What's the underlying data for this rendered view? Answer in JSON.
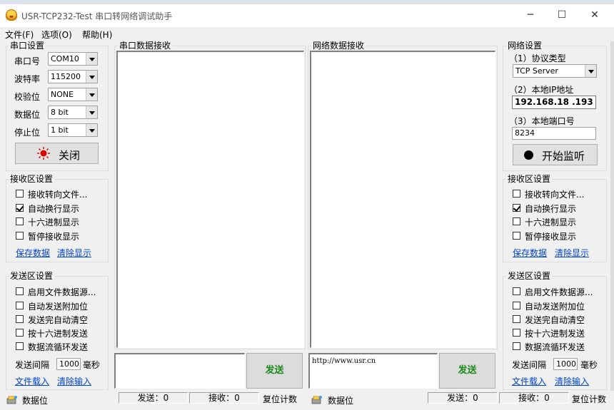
{
  "window": {
    "title": "USR-TCP232-Test 串口转网络调试助手",
    "minimize": "─",
    "maximize": "☐",
    "close": "✕"
  },
  "menu": [
    "文件(F)",
    "选项(O)",
    "帮助(H)"
  ],
  "serial": {
    "group_title": "串口设置",
    "port_label": "串口号",
    "port_value": "COM10",
    "baud_label": "波特率",
    "baud_value": "115200",
    "parity_label": "校验位",
    "parity_value": "NONE",
    "databits_label": "数据位",
    "databits_value": "8 bit",
    "stopbits_label": "停止位",
    "stopbits_value": "1 bit",
    "close_button": "关闭"
  },
  "left_recv": {
    "group_title": "接收区设置",
    "options": [
      {
        "label": "接收转向文件...",
        "checked": false
      },
      {
        "label": "自动换行显示",
        "checked": true
      },
      {
        "label": "十六进制显示",
        "checked": false
      },
      {
        "label": "暂停接收显示",
        "checked": false
      }
    ],
    "save_link": "保存数据",
    "clear_link": "清除显示"
  },
  "left_send": {
    "group_title": "发送区设置",
    "options": [
      {
        "label": "启用文件数据源...",
        "checked": false
      },
      {
        "label": "自动发送附加位",
        "checked": false
      },
      {
        "label": "发送完自动清空",
        "checked": false
      },
      {
        "label": "按十六进制发送",
        "checked": false
      },
      {
        "label": "数据流循环发送",
        "checked": false
      }
    ],
    "interval_label": "发送间隔",
    "interval_value": "1000",
    "interval_unit": "毫秒",
    "file_link": "文件载入",
    "clear_link": "清除输入"
  },
  "serial_recv_title": "串口数据接收",
  "net_recv_title": "网络数据接收",
  "serial_send_button": "发送",
  "net_send_text": "http://www.usr.cn",
  "net_send_button": "发送",
  "network": {
    "group_title": "网络设置",
    "protocol_label": "（1）协议类型",
    "protocol_value": "TCP Server",
    "ip_label": "（2）本地IP地址",
    "ip_value": "192.168.18 .193",
    "port_label": "（3）本地端口号",
    "port_value": "8234",
    "listen_button": "开始监听"
  },
  "right_recv": {
    "group_title": "接收区设置",
    "options": [
      {
        "label": "接收转向文件...",
        "checked": false
      },
      {
        "label": "自动换行显示",
        "checked": true
      },
      {
        "label": "十六进制显示",
        "checked": false
      },
      {
        "label": "暂停接收显示",
        "checked": false
      }
    ],
    "save_link": "保存数据",
    "clear_link": "清除显示"
  },
  "right_send": {
    "group_title": "发送区设置",
    "options": [
      {
        "label": "启用文件数据源...",
        "checked": false
      },
      {
        "label": "自动发送附加位",
        "checked": false
      },
      {
        "label": "发送完自动清空",
        "checked": false
      },
      {
        "label": "按十六进制发送",
        "checked": false
      },
      {
        "label": "数据流循环发送",
        "checked": false
      }
    ],
    "interval_label": "发送间隔",
    "interval_value": "1000",
    "interval_unit": "毫秒",
    "file_link": "文件载入",
    "clear_link": "清除输入"
  },
  "status_left": {
    "label": "数据位",
    "sent": "发送：0",
    "recv": "接收：0",
    "reset": "复位计数"
  },
  "status_right": {
    "label": "数据位",
    "sent": "发送：0",
    "recv": "接收：0",
    "reset": "复位计数"
  }
}
